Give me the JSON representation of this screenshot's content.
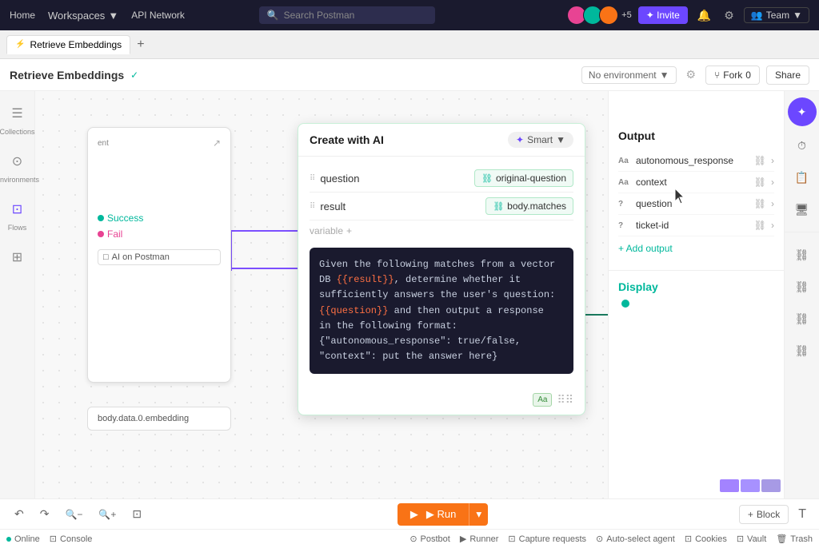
{
  "nav": {
    "home": "Home",
    "workspaces": "Workspaces",
    "workspaces_chevron": "▼",
    "api_network": "API Network",
    "search_placeholder": "Search Postman",
    "search_icon": "🔍",
    "avatar_count": "+5",
    "invite_label": "✦ Invite",
    "bell_icon": "🔔",
    "settings_icon": "⚙",
    "team_label": "Team",
    "team_chevron": "▼"
  },
  "tabs": {
    "active_tab": "Retrieve Embeddings",
    "tab_icon": "⚡",
    "add_tab": "+"
  },
  "action_bar": {
    "title": "Retrieve Embeddings",
    "verified": "✓",
    "fork_icon": "⑂",
    "fork_count": "0",
    "fork_label": "Fork",
    "share_label": "Share",
    "env_label": "No environment",
    "env_chevron": "▼",
    "settings_icon": "⚙"
  },
  "sidebar": {
    "collections_icon": "☰",
    "collections_label": "Collections",
    "environments_icon": "⊙",
    "environments_label": "Environments",
    "flows_icon": "⊡",
    "flows_label": "Flows",
    "explore_icon": "⊞",
    "explore_label": ""
  },
  "create_ai_bar": {
    "label": "Create with AI",
    "prev_arrow": "‹",
    "next_arrow": "›",
    "square_icon": "□"
  },
  "ai_node": {
    "title": "Create with AI",
    "smart_label": "Smart",
    "smart_icon": "✦",
    "chevron": "▼",
    "input1_name": "question",
    "input1_value": "original-question",
    "input2_name": "result",
    "input2_value": "body.matches",
    "add_var": "variable",
    "add_plus": "+",
    "prompt_text": "Given the following matches from a vector\nDB {{result}}, determine whether it\nsufficiently answers the user's question:\n{{question}} and then output a response\nin the following format:\n{\"autonomous_response\": true/false,\n\"context\": put the answer here}",
    "prompt_var1": "{{result}}",
    "prompt_var2": "{{question}}",
    "aa_label": "Aa"
  },
  "left_node": {
    "type_label": "ent",
    "expand_icon": "↗",
    "success_label": "Success",
    "fail_label": "Fail",
    "ai_icon": "□",
    "ai_label": "AI on Postman"
  },
  "embedding_node": {
    "label": "body.data.0.embedding"
  },
  "output_panel": {
    "title": "Output",
    "rows": [
      {
        "type": "Aa",
        "name": "autonomous_response"
      },
      {
        "type": "Aa",
        "name": "context"
      },
      {
        "type": "?",
        "name": "question"
      },
      {
        "type": "?",
        "name": "ticket-id"
      }
    ],
    "add_label": "+ Add output"
  },
  "display_panel": {
    "title": "Display"
  },
  "far_sidebar": {
    "ai_icon": "✦",
    "history_icon": "⏱",
    "doc_icon": "📋",
    "monitor_icon": "🖥",
    "link_icon1": "⛓",
    "link_icon2": "⛓",
    "link_icon3": "⛓",
    "link_icon4": "⛓"
  },
  "toolbar": {
    "undo_icon": "↶",
    "redo_icon": "↷",
    "zoom_out_icon": "🔍−",
    "zoom_in_icon": "🔍+",
    "fit_icon": "⊡",
    "run_label": "▶ Run",
    "run_dropdown": "▾",
    "block_label": "+ Block",
    "text_icon": "T"
  },
  "status_bar": {
    "online_dot": "●",
    "online_label": "Online",
    "console_icon": "⊡",
    "console_label": "Console",
    "postbot_icon": "⊙",
    "postbot_label": "Postbot",
    "runner_icon": "▶",
    "runner_label": "Runner",
    "capture_icon": "⊡",
    "capture_label": "Capture requests",
    "auto_select_icon": "⊙",
    "auto_select_label": "Auto-select agent",
    "cookies_icon": "⊡",
    "cookies_label": "Cookies",
    "vault_icon": "⊡",
    "vault_label": "Vault",
    "trash_icon": "🗑",
    "trash_label": "Trash"
  },
  "colors": {
    "accent_purple": "#6c47ff",
    "accent_green": "#00b89c",
    "accent_orange": "#f97316",
    "accent_pink": "#e84393",
    "border": "#ddd",
    "bg": "#f8f8f8"
  }
}
